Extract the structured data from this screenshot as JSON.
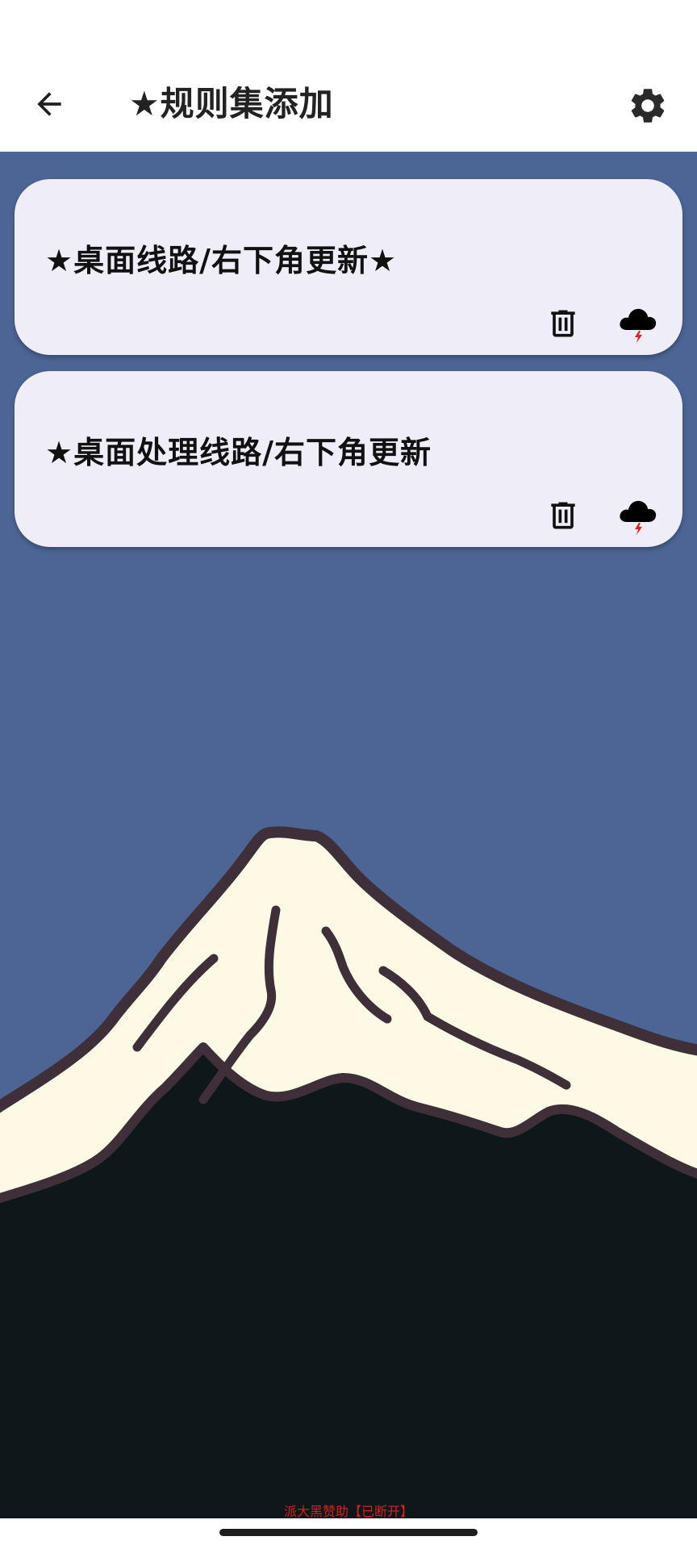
{
  "app_bar": {
    "title": "★规则集添加",
    "back_icon": "arrow-left-icon",
    "settings_icon": "gear-icon"
  },
  "rule_sets": [
    {
      "name": "★桌面线路/右下角更新★",
      "delete_icon": "trash-icon",
      "update_icon": "cloud-lightning-icon"
    },
    {
      "name": "★桌面处理线路/右下角更新",
      "delete_icon": "trash-icon",
      "update_icon": "cloud-lightning-icon"
    }
  ],
  "footer": {
    "status": "派大黑赞助【已断开】"
  },
  "colors": {
    "background": "#4c6594",
    "card": "#eeedf8",
    "snow": "#fdf9e4",
    "mountain_outline": "#3e2f38",
    "mountain_base": "#0e1719",
    "status_text": "#d82020"
  }
}
